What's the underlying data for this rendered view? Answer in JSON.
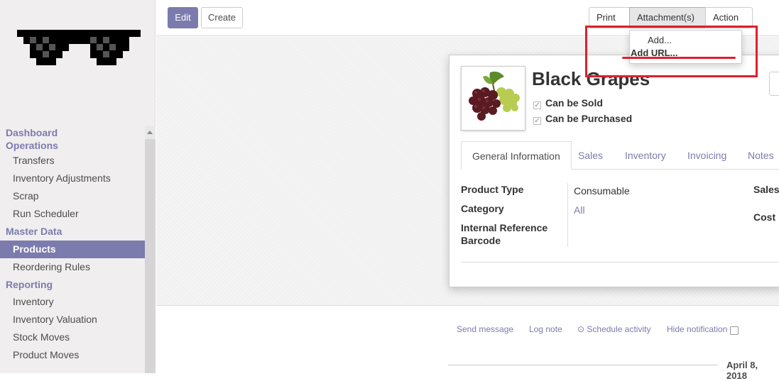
{
  "sidebar": {
    "sections": [
      {
        "label": "Dashboard"
      },
      {
        "label": "Operations"
      },
      {
        "label": "Master Data"
      },
      {
        "label": "Reporting"
      }
    ],
    "items": [
      {
        "label": "Transfers"
      },
      {
        "label": "Inventory Adjustments"
      },
      {
        "label": "Scrap"
      },
      {
        "label": "Run Scheduler"
      },
      {
        "label": "Products"
      },
      {
        "label": "Reordering Rules"
      },
      {
        "label": "Inventory"
      },
      {
        "label": "Inventory Valuation"
      },
      {
        "label": "Stock Moves"
      },
      {
        "label": "Product Moves"
      }
    ],
    "active_item": "Products"
  },
  "toolbar": {
    "edit_label": "Edit",
    "create_label": "Create",
    "print_label": "Print",
    "attachments_label": "Attachment(s)",
    "action_label": "Action"
  },
  "attachment_menu": {
    "items": [
      {
        "label": "Add..."
      },
      {
        "label": "Add URL..."
      }
    ]
  },
  "product": {
    "name": "Black Grapes",
    "can_be_sold_label": "Can be Sold",
    "can_be_purchased_label": "Can be Purchased",
    "can_be_sold": true,
    "can_be_purchased": true
  },
  "tabs": [
    {
      "label": "General Information",
      "active": true
    },
    {
      "label": "Sales"
    },
    {
      "label": "Inventory"
    },
    {
      "label": "Invoicing"
    },
    {
      "label": "Notes"
    }
  ],
  "fields": {
    "product_type": {
      "label": "Product Type",
      "value": "Consumable"
    },
    "category": {
      "label": "Category",
      "value": "All"
    },
    "internal_reference": {
      "label": "Internal Reference"
    },
    "barcode": {
      "label": "Barcode"
    },
    "sales_price": {
      "label": "Sales"
    },
    "cost": {
      "label": "Cost"
    }
  },
  "chatter": {
    "send_message": "Send message",
    "log_note": "Log note",
    "schedule_activity": "Schedule activity",
    "hide_notification": "Hide notification",
    "date": "April 8, 2018"
  },
  "colors": {
    "accent": "#7c7bad",
    "annotation": "#e0202c"
  }
}
